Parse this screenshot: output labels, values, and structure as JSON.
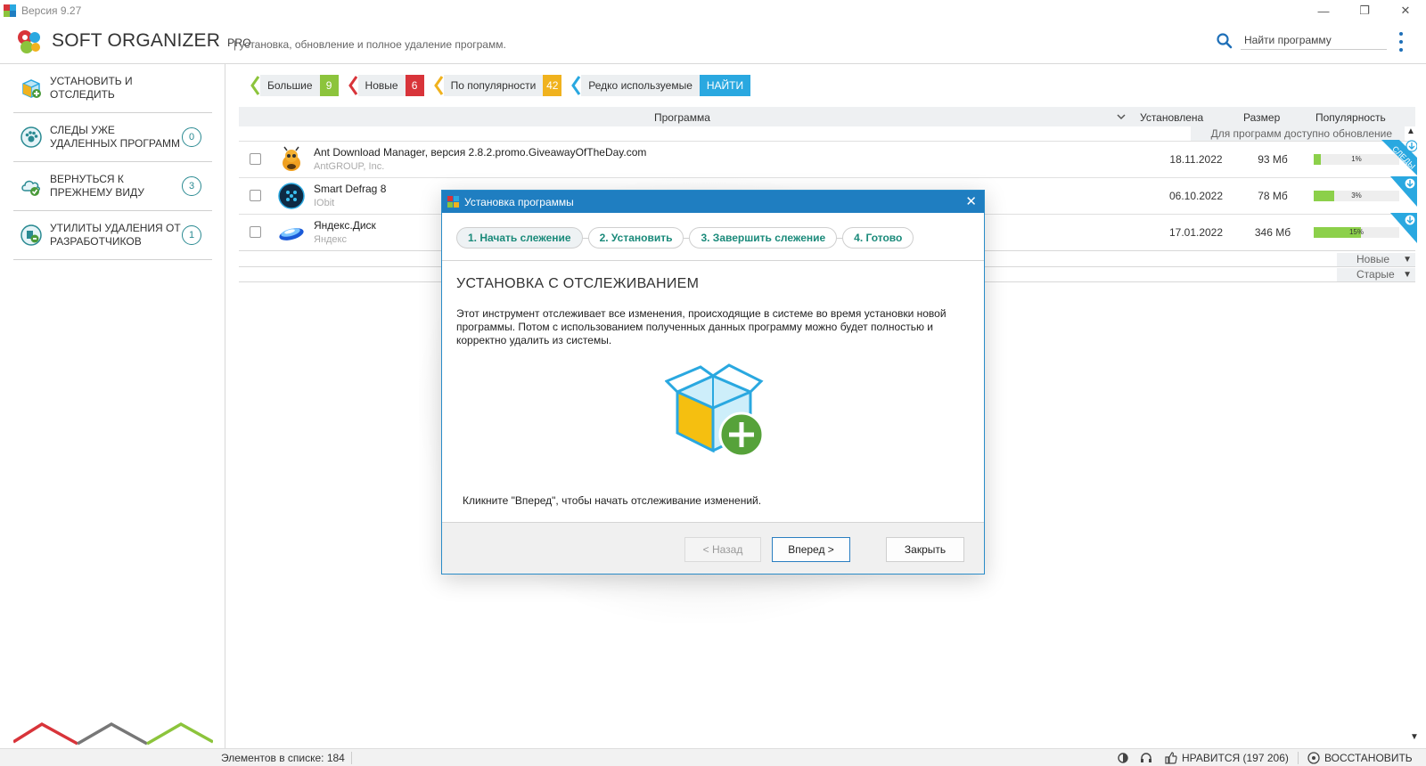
{
  "window": {
    "version": "Версия 9.27",
    "controls": {
      "minimize": "—",
      "restore": "❐",
      "close": "✕"
    }
  },
  "header": {
    "brand": "SOFT ORGANIZER",
    "pro": "PRO",
    "tagline": "| установка, обновление и полное удаление программ.",
    "search_placeholder": "Найти программу"
  },
  "sidebar": {
    "items": [
      {
        "label": "Установить и отследить",
        "count": null
      },
      {
        "label": "Следы уже удаленных программ",
        "count": "0"
      },
      {
        "label": "Вернуться к прежнему виду",
        "count": "3"
      },
      {
        "label": "Утилиты удаления от разработчиков",
        "count": "1"
      }
    ]
  },
  "filters": {
    "items": [
      {
        "label": "Большие",
        "count": "9",
        "color": "#8cc43c"
      },
      {
        "label": "Новые",
        "count": "6",
        "color": "#d8343a"
      },
      {
        "label": "По популярности",
        "count": "42",
        "color": "#f0b21e"
      },
      {
        "label": "Редко используемые",
        "count": null,
        "color": "#2aa8e0"
      }
    ],
    "find_label": "НАЙТИ"
  },
  "table": {
    "columns": {
      "program": "Программа",
      "installed": "Установлена",
      "size": "Размер",
      "popularity": "Популярность"
    },
    "update_note": "Для программ доступно обновление",
    "rows": [
      {
        "name": "Ant Download Manager, версия 2.8.2.promo.GiveawayOfTheDay.com",
        "vendor": "AntGROUP, Inc.",
        "date": "18.11.2022",
        "size": "93 Мб",
        "popularity": "1%",
        "popularity_value": 0.08
      },
      {
        "name": "Smart Defrag 8",
        "vendor": "IObit",
        "date": "06.10.2022",
        "size": "78 Мб",
        "popularity": "3%",
        "popularity_value": 0.24
      },
      {
        "name": "Яндекс.Диск",
        "vendor": "Яндекс",
        "date": "17.01.2022",
        "size": "346 Мб",
        "popularity": "15%",
        "popularity_value": 0.55
      }
    ],
    "traces_label": "СЛЕДЫ",
    "groups": {
      "new": "Новые",
      "old": "Старые"
    }
  },
  "status": {
    "count": "Элементов в списке: 184",
    "likes": "Нравится (197 206)",
    "restore": "Восстановить"
  },
  "dialog": {
    "title": "Установка программы",
    "steps": [
      "1. Начать слежение",
      "2. Установить",
      "3. Завершить слежение",
      "4. Готово"
    ],
    "heading": "УСТАНОВКА С ОТСЛЕЖИВАНИЕМ",
    "description": "Этот инструмент отслеживает все изменения, происходящие в системе во время установки новой программы. Потом с использованием полученных данных программу можно будет полностью и корректно удалить из системы.",
    "hint": "Кликните \"Вперед\", чтобы начать отслеживание изменений.",
    "buttons": {
      "back": "< Назад",
      "next": "Вперед >",
      "close": "Закрыть"
    }
  },
  "colors": {
    "accent": "#1f7ec1",
    "green": "#8cd04a",
    "teal": "#2a8a92"
  }
}
